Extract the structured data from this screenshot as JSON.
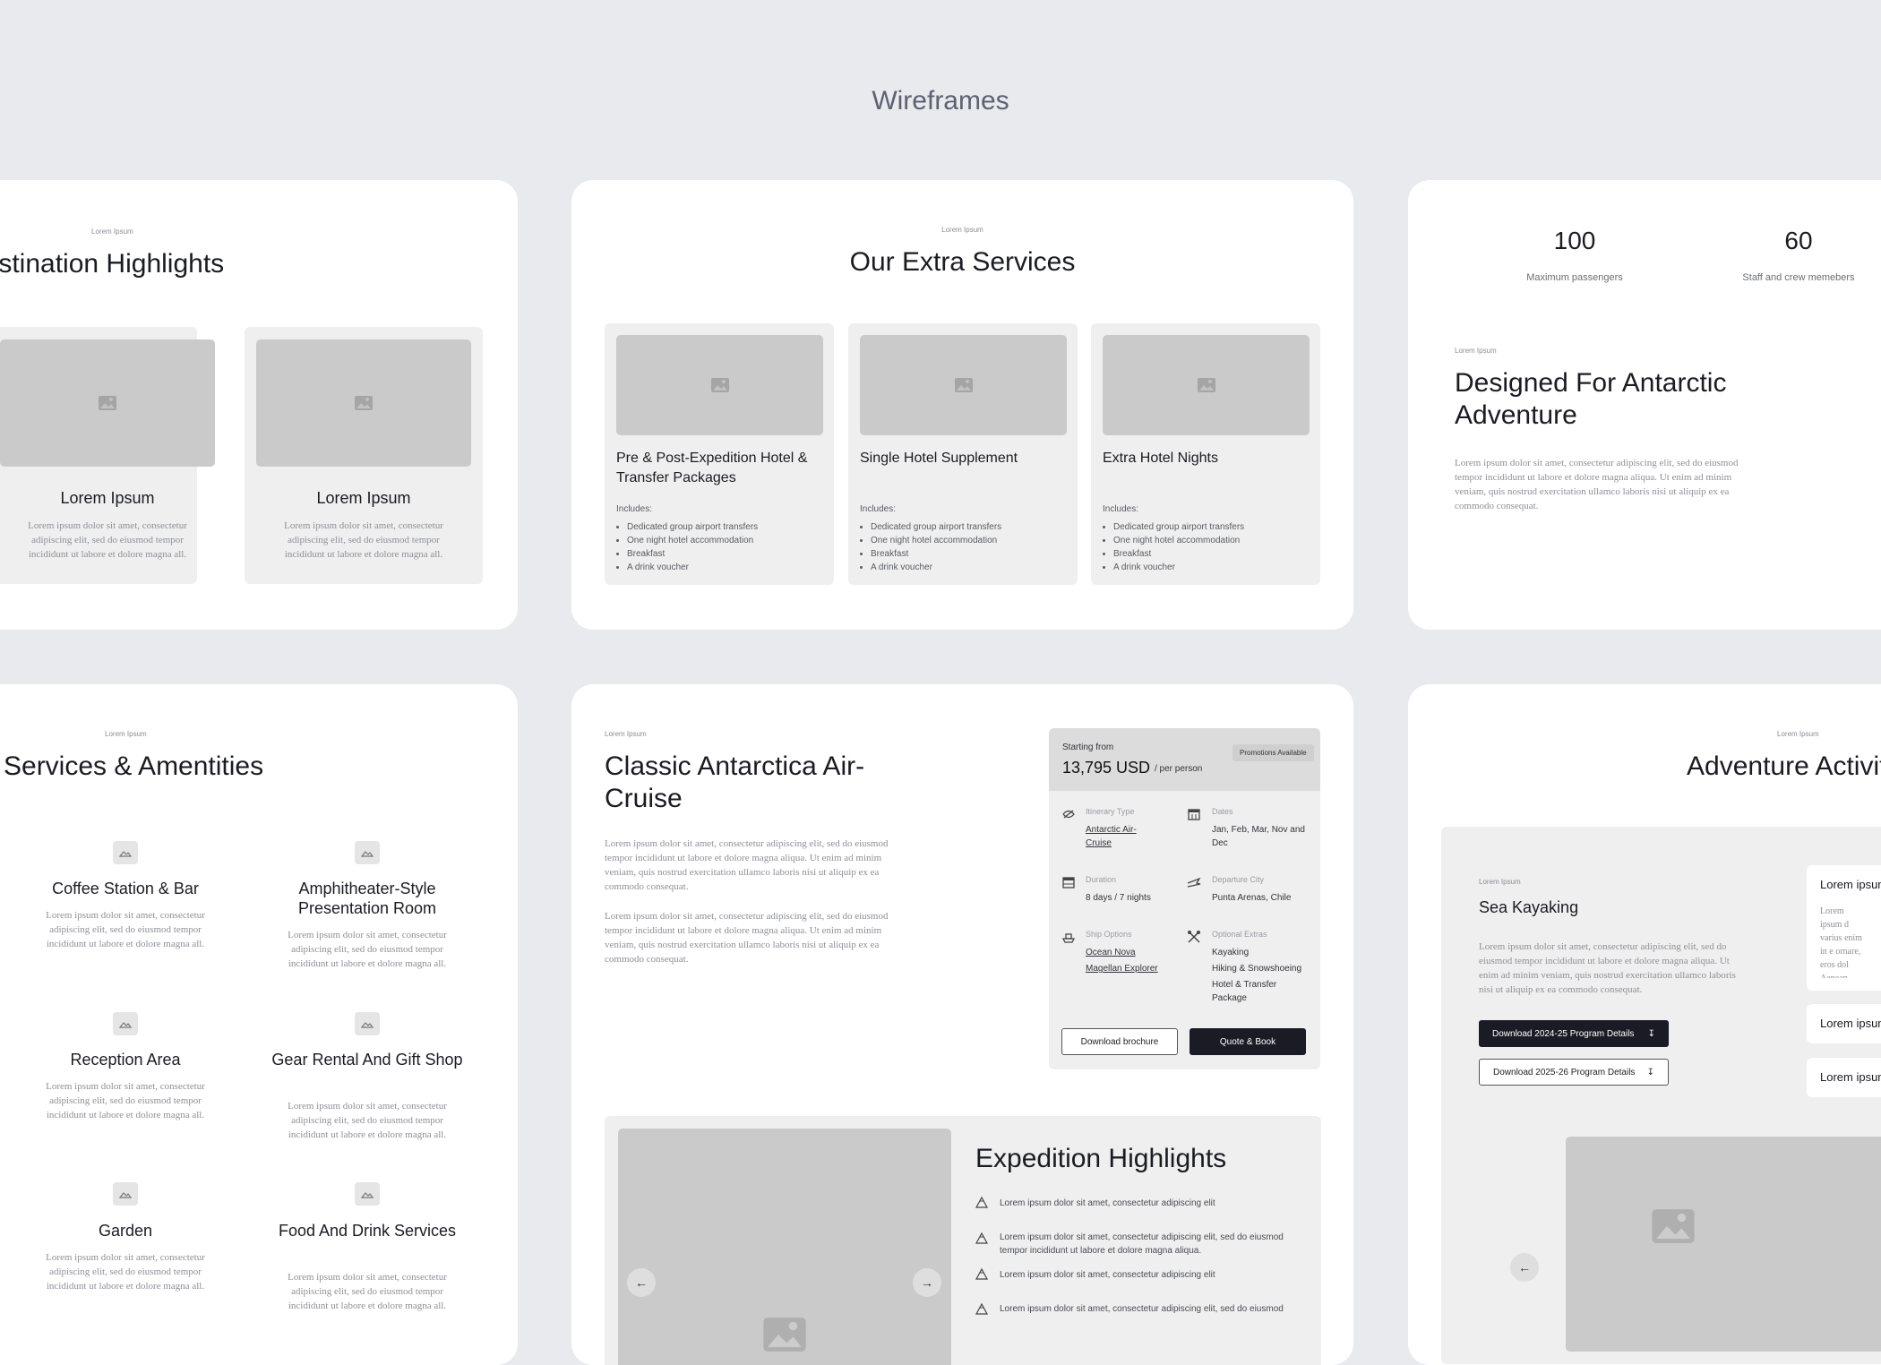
{
  "title": "Wireframes",
  "card_destinations": {
    "eyebrow": "Lorem Ipsum",
    "heading": "Destination Highlights",
    "items": [
      {
        "title": "Lorem Ipsum",
        "desc": "Lorem ipsum dolor sit amet, consectetur adipiscing elit, sed do eiusmod tempor incididunt ut labore et dolore magna all."
      },
      {
        "title": "Lorem Ipsum",
        "desc": "Lorem ipsum dolor sit amet, consectetur adipiscing elit, sed do eiusmod tempor incididunt ut labore et dolore magna all."
      }
    ]
  },
  "card_services": {
    "eyebrow": "Lorem Ipsum",
    "heading": "Our Extra Services",
    "includes_label": "Includes:",
    "items": [
      {
        "title": "Pre & Post-Expedition Hotel & Transfer Packages",
        "bullets": [
          "Dedicated group airport transfers",
          "One night hotel accommodation",
          "Breakfast",
          "A drink voucher"
        ]
      },
      {
        "title": "Single Hotel Supplement",
        "bullets": [
          "Dedicated group airport transfers",
          "One night hotel accommodation",
          "Breakfast",
          "A drink voucher"
        ]
      },
      {
        "title": "Extra Hotel Nights",
        "bullets": [
          "Dedicated group airport transfers",
          "One night hotel accommodation",
          "Breakfast",
          "A drink voucher"
        ]
      }
    ]
  },
  "card_stats": {
    "stats": [
      {
        "value": "100",
        "label": "Maximum passengers"
      },
      {
        "value": "60",
        "label": "Staff and crew memebers"
      }
    ],
    "eyebrow": "Lorem Ipsum",
    "heading": "Designed For Antarctic Adventure",
    "body": "Lorem ipsum dolor sit amet, consectetur adipiscing elit, sed do eiusmod tempor incididunt ut labore et dolore magna aliqua. Ut enim ad minim veniam, quis nostrud exercitation ullamco laboris nisi ut aliquip ex ea commodo consequat."
  },
  "card_amenities": {
    "eyebrow": "Lorem Ipsum",
    "heading": "Services & Amentities",
    "desc": "Lorem ipsum dolor sit amet, consectetur adipiscing elit, sed do eiusmod tempor incididunt ut labore et dolore magna all.",
    "items": [
      {
        "title": "Coffee Station & Bar"
      },
      {
        "title": "Amphitheater-Style Presentation Room"
      },
      {
        "title": "Reception Area"
      },
      {
        "title": "Gear Rental And Gift Shop"
      },
      {
        "title": "Garden"
      },
      {
        "title": "Food And Drink Services"
      }
    ]
  },
  "card_cruise": {
    "eyebrow": "Lorem Ipsum",
    "heading": "Classic Antarctica Air-Cruise",
    "body": "Lorem ipsum dolor sit amet, consectetur adipiscing elit, sed do eiusmod tempor incididunt ut labore et dolore magna aliqua. Ut enim ad minim veniam, quis nostrud exercitation ullamco laboris nisi ut aliquip ex ea commodo consequat.",
    "price": {
      "starting_label": "Starting from",
      "amount": "13,795 USD",
      "per": "/ per person",
      "promo": "Promotions Available"
    },
    "details": {
      "itinerary_label": "Itinerary Type",
      "itinerary_value": "Antarctic Air-Cruise",
      "dates_label": "Dates",
      "dates_value": "Jan, Feb, Mar, Nov and Dec",
      "duration_label": "Duration",
      "duration_value": "8 days / 7 nights",
      "departure_label": "Departure City",
      "departure_value": "Punta Arenas, Chile",
      "ship_label": "Ship Options",
      "ship_values": [
        "Ocean Nova",
        "Magellan Explorer"
      ],
      "extras_label": "Optional Extras",
      "extras_values": [
        "Kayaking",
        "Hiking & Snowshoeing",
        "Hotel & Transfer Package"
      ]
    },
    "download_label": "Download brochure",
    "quote_label": "Quote & Book",
    "highlights_heading": "Expedition Highlights",
    "highlights": [
      "Lorem ipsum dolor sit amet, consectetur adipiscing elit",
      "Lorem ipsum dolor sit amet, consectetur adipiscing elit, sed do eiusmod tempor incididunt ut labore et dolore magna aliqua.",
      "Lorem ipsum dolor sit amet, consectetur adipiscing elit",
      "Lorem ipsum dolor sit amet, consectetur adipiscing elit, sed do eiusmod"
    ]
  },
  "card_activities": {
    "eyebrow": "Lorem Ipsum",
    "heading": "Adventure Activities",
    "inner_eyebrow": "Lorem Ipsum",
    "activity": "Sea Kayaking",
    "body": "Lorem ipsum dolor sit amet, consectetur adipiscing elit, sed do eiusmod tempor incididunt ut labore et dolore magna aliqua. Ut enim ad minim veniam, quis nostrud exercitation ullamco laboris nisi ut aliquip ex ea commodo consequat.",
    "btn1": "Download 2024-25 Program Details",
    "btn2": "Download 2025-26 Program Details",
    "accordion": [
      {
        "title": "Lorem ipsum",
        "body": "Lorem ipsum d varius enim in e ornare, eros dol Aenean faucibu ut sem vitae ris"
      },
      {
        "title": "Lorem ipsum"
      },
      {
        "title": "Lorem ipsum"
      }
    ]
  }
}
